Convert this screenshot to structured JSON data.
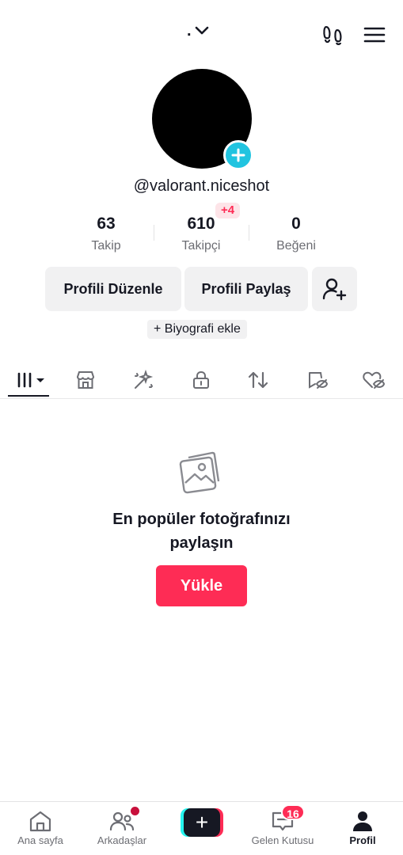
{
  "header": {
    "title": ".",
    "icons": [
      "chevron-down-icon",
      "footprints-icon",
      "menu-icon"
    ]
  },
  "profile": {
    "username": "@valorant.niceshot",
    "followers_badge": "+4",
    "stats": [
      {
        "value": "63",
        "label": "Takip"
      },
      {
        "value": "610",
        "label": "Takipçi"
      },
      {
        "value": "0",
        "label": "Beğeni"
      }
    ],
    "edit_label": "Profili Düzenle",
    "share_label": "Profili Paylaş",
    "bio_label": "+ Biyografi ekle"
  },
  "tabs": [
    {
      "name": "videos",
      "icon": "grid-icon"
    },
    {
      "name": "shop",
      "icon": "shop-icon"
    },
    {
      "name": "effects",
      "icon": "magic-wand-icon"
    },
    {
      "name": "private",
      "icon": "lock-icon"
    },
    {
      "name": "reposts",
      "icon": "repost-icon"
    },
    {
      "name": "favorites",
      "icon": "bookmark-hidden-icon"
    },
    {
      "name": "liked",
      "icon": "heart-hidden-icon"
    }
  ],
  "empty_state": {
    "icon": "photo-icon",
    "title_line1": "En popüler fotoğrafınızı",
    "title_line2": "paylaşın",
    "upload_label": "Yükle"
  },
  "bottom_nav": {
    "home": "Ana sayfa",
    "friends": "Arkadaşlar",
    "inbox": "Gelen Kutusu",
    "inbox_count": "16",
    "profile": "Profil",
    "create_icon": "+"
  },
  "colors": {
    "accent": "#fe2c55",
    "teal": "#21c4e0",
    "text": "#161823",
    "muted": "#6c6d73",
    "chip_bg": "#f1f1f2"
  }
}
